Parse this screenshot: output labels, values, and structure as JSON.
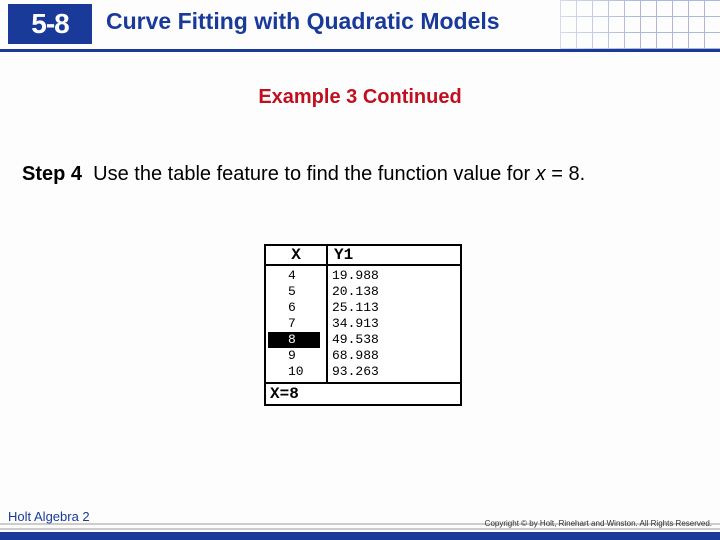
{
  "lesson": {
    "number": "5-8",
    "title": "Curve Fitting with Quadratic Models"
  },
  "example_heading": "Example 3 Continued",
  "step": {
    "label": "Step 4",
    "text_before": "Use the table feature to find the function value for ",
    "var": "x",
    "text_after": " = 8."
  },
  "calc": {
    "col_x": "X",
    "col_y": "Y1",
    "rows": [
      {
        "x": "4",
        "y": "19.988",
        "selected": false
      },
      {
        "x": "5",
        "y": "20.138",
        "selected": false
      },
      {
        "x": "6",
        "y": "25.113",
        "selected": false
      },
      {
        "x": "7",
        "y": "34.913",
        "selected": false
      },
      {
        "x": "8",
        "y": "49.538",
        "selected": true
      },
      {
        "x": "9",
        "y": "68.988",
        "selected": false
      },
      {
        "x": "10",
        "y": "93.263",
        "selected": false
      }
    ],
    "footer": "X=8"
  },
  "footer": {
    "book": "Holt Algebra 2",
    "copyright": "Copyright © by Holt, Rinehart and Winston. All Rights Reserved."
  }
}
